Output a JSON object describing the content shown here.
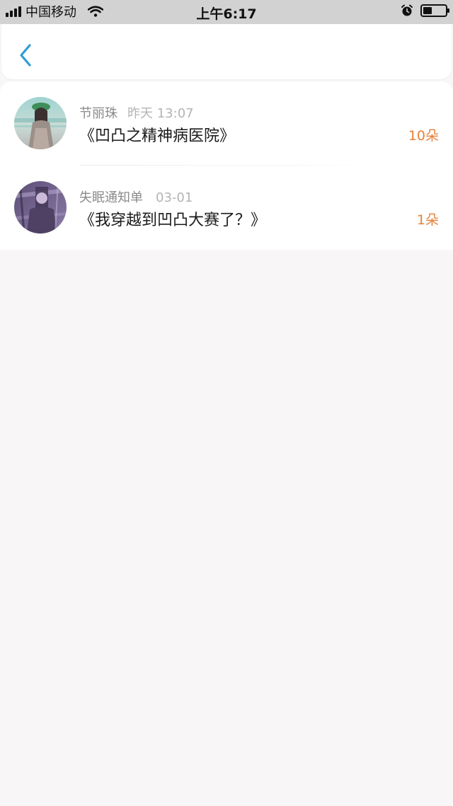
{
  "status_bar": {
    "carrier": "中国移动",
    "time": "上午6:17"
  },
  "nav": {
    "back_icon": "chevron-left-icon",
    "accent": "#2f9bd8"
  },
  "items": [
    {
      "name": "节丽珠",
      "time": "昨天 13:07",
      "title": "《凹凸之精神病医院》",
      "count": "10朵"
    },
    {
      "name": "失眠通知单",
      "time": "03-01",
      "title": "《我穿越到凹凸大赛了？》",
      "count": "1朵"
    }
  ],
  "colors": {
    "count": "#e6813a",
    "page_background": "#f8f6f7"
  }
}
